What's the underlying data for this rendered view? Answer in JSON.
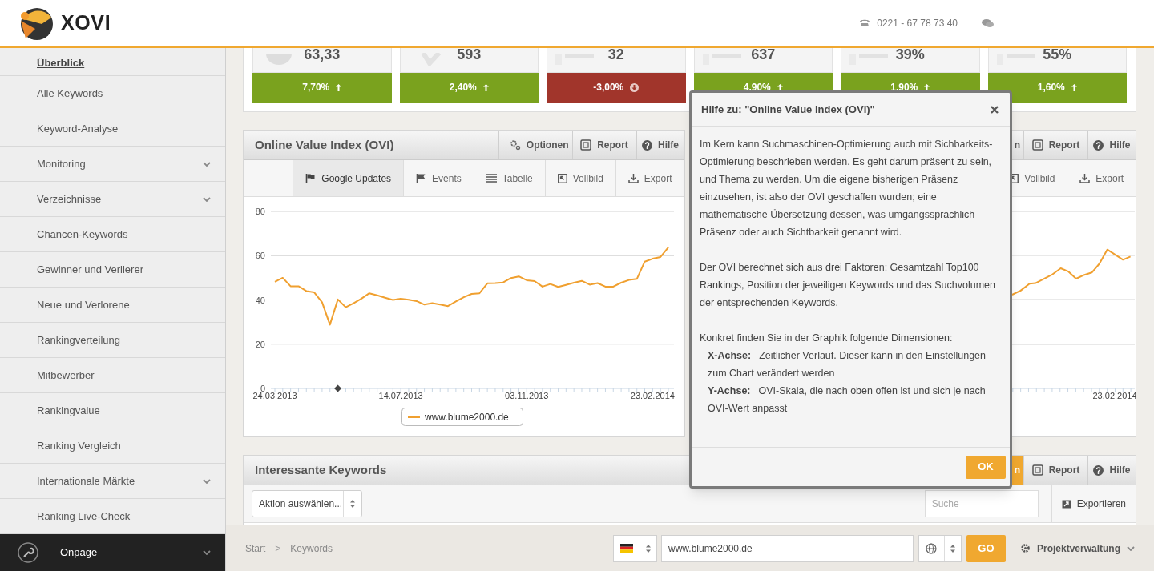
{
  "header": {
    "brand": "XOVI",
    "phone": "0221 - 67 78 73 40"
  },
  "sidebar": {
    "items": [
      {
        "label": "Überblick",
        "selected": true,
        "expandable": false
      },
      {
        "label": "Alle Keywords",
        "selected": false,
        "expandable": false
      },
      {
        "label": "Keyword-Analyse",
        "selected": false,
        "expandable": false
      },
      {
        "label": "Monitoring",
        "selected": false,
        "expandable": true
      },
      {
        "label": "Verzeichnisse",
        "selected": false,
        "expandable": true
      },
      {
        "label": "Chancen-Keywords",
        "selected": false,
        "expandable": false
      },
      {
        "label": "Gewinner und Verlierer",
        "selected": false,
        "expandable": false
      },
      {
        "label": "Neue und Verlorene",
        "selected": false,
        "expandable": false
      },
      {
        "label": "Rankingverteilung",
        "selected": false,
        "expandable": false
      },
      {
        "label": "Mitbewerber",
        "selected": false,
        "expandable": false
      },
      {
        "label": "Rankingvalue",
        "selected": false,
        "expandable": false
      },
      {
        "label": "Ranking Vergleich",
        "selected": false,
        "expandable": false
      },
      {
        "label": "Internationale Märkte",
        "selected": false,
        "expandable": true
      },
      {
        "label": "Ranking Live-Check",
        "selected": false,
        "expandable": false
      }
    ],
    "footer_item": {
      "label": "Onpage",
      "expandable": true
    }
  },
  "stats": [
    {
      "kind": "pie",
      "value": "63,33",
      "change": "7,70%",
      "rising": true
    },
    {
      "kind": "check",
      "value": "593",
      "change": "2,40%",
      "rising": true
    },
    {
      "kind": "bars",
      "value": "32",
      "change": "-3,00%",
      "rising": false
    },
    {
      "kind": "bars",
      "value": "637",
      "change": "4,90%",
      "rising": true
    },
    {
      "kind": "bars",
      "value": "39%",
      "change": "1,90%",
      "rising": true
    },
    {
      "kind": "bars",
      "value": "55%",
      "change": "1,60%",
      "rising": true
    }
  ],
  "ovi_panel": {
    "title": "Online Value Index (OVI)",
    "header_buttons": [
      {
        "label": "Optionen",
        "kind": "options"
      },
      {
        "label": "Report",
        "kind": "report"
      },
      {
        "label": "Hilfe",
        "kind": "help"
      }
    ],
    "toolbar": [
      {
        "label": "Google Updates",
        "kind": "flag",
        "selected": true
      },
      {
        "label": "Events",
        "kind": "events",
        "selected": false
      },
      {
        "label": "Tabelle",
        "kind": "table",
        "selected": false
      },
      {
        "label": "Vollbild",
        "kind": "fullscreen",
        "selected": false
      },
      {
        "label": "Export",
        "kind": "export",
        "selected": false
      }
    ],
    "chart_data": {
      "type": "line",
      "categories": [
        "24.03.2013",
        null,
        null,
        null,
        null,
        null,
        null,
        null,
        null,
        null,
        null,
        null,
        null,
        null,
        null,
        null,
        "14.07.2013",
        null,
        null,
        null,
        null,
        null,
        null,
        null,
        null,
        null,
        null,
        null,
        null,
        null,
        null,
        null,
        "03.11.2013",
        null,
        null,
        null,
        null,
        null,
        null,
        null,
        null,
        null,
        null,
        null,
        null,
        null,
        null,
        null,
        "23.02.2014",
        null,
        null
      ],
      "ylim": [
        0,
        80
      ],
      "yticks": [
        0,
        20,
        40,
        60,
        80
      ],
      "grid": true,
      "series": [
        {
          "name": "www.blume2000.de",
          "color": "#f0a030",
          "values": [
            48.2,
            50,
            46.2,
            46.2,
            44,
            43.4,
            39,
            28.8,
            40.2,
            36.7,
            38.5,
            40.6,
            43,
            42.1,
            41,
            40,
            40.5,
            40.1,
            39.5,
            37.9,
            38.6,
            37.9,
            37.2,
            39.3,
            41.2,
            42.7,
            43,
            47.5,
            47.6,
            47.9,
            49.9,
            50.6,
            48.9,
            48.5,
            46,
            47.2,
            45.9,
            46.8,
            47.8,
            48.6,
            46.9,
            47.6,
            46,
            46,
            47.8,
            49,
            49.5,
            57.3,
            58.6,
            59.4,
            63.8
          ]
        }
      ],
      "annotations": [
        {
          "x": "8"
        }
      ]
    }
  },
  "second_panel": {
    "header_buttons": [
      {
        "label": "n",
        "kind": "options"
      },
      {
        "label": "Report",
        "kind": "report"
      },
      {
        "label": "Hilfe",
        "kind": "help"
      }
    ],
    "toolbar": [
      {
        "label": "Vollbild",
        "kind": "fullscreen",
        "selected": false
      },
      {
        "label": "Export",
        "kind": "export",
        "selected": false
      }
    ],
    "x_label": "23.02.2014"
  },
  "keywords_panel": {
    "title": "Interessante Keywords",
    "header_buttons": [
      {
        "label": "n",
        "kind": "options",
        "active": true
      },
      {
        "label": "Report",
        "kind": "report",
        "active": false
      },
      {
        "label": "Hilfe",
        "kind": "help",
        "active": false
      }
    ],
    "action_select": "Aktion auswählen...",
    "search": {
      "placeholder": "Suche"
    },
    "export_button": "Exportieren"
  },
  "footer": {
    "breadcrumbs": [
      "Start",
      "Keywords"
    ],
    "separator": ">",
    "url": "www.blume2000.de",
    "go": "GO",
    "project_menu": "Projektverwaltung"
  },
  "modal": {
    "title": "Hilfe zu: \"Online Value Index (OVI)\"",
    "paragraphs": [
      "Im Kern kann Suchmaschinen-Optimierung auch mit Sichbarkeits-Optimierung beschrieben werden. Es geht darum präsent zu sein, und Thema zu werden. Um die eigene bisherigen Präsenz einzusehen, ist also der OVI geschaffen wurden; eine mathematische Übersetzung dessen, was umgangssprachlich Präsenz oder auch Sichtbarkeit genannt wird.",
      "Der OVI berechnet sich aus drei Faktoren: Gesamtzahl Top100 Rankings, Position der jeweiligen Keywords und das Suchvolumen der entsprechenden Keywords.",
      "Konkret finden Sie in der Graphik folgende Dimensionen:"
    ],
    "definitions": [
      {
        "term": "X-Achse:",
        "text": "Zeitlicher Verlauf. Dieser kann in den Einstellungen zum Chart verändert werden"
      },
      {
        "term": "Y-Achse:",
        "text": "OVI-Skala, die nach oben offen ist und sich je nach OVI-Wert anpasst"
      }
    ],
    "ok": "OK"
  }
}
